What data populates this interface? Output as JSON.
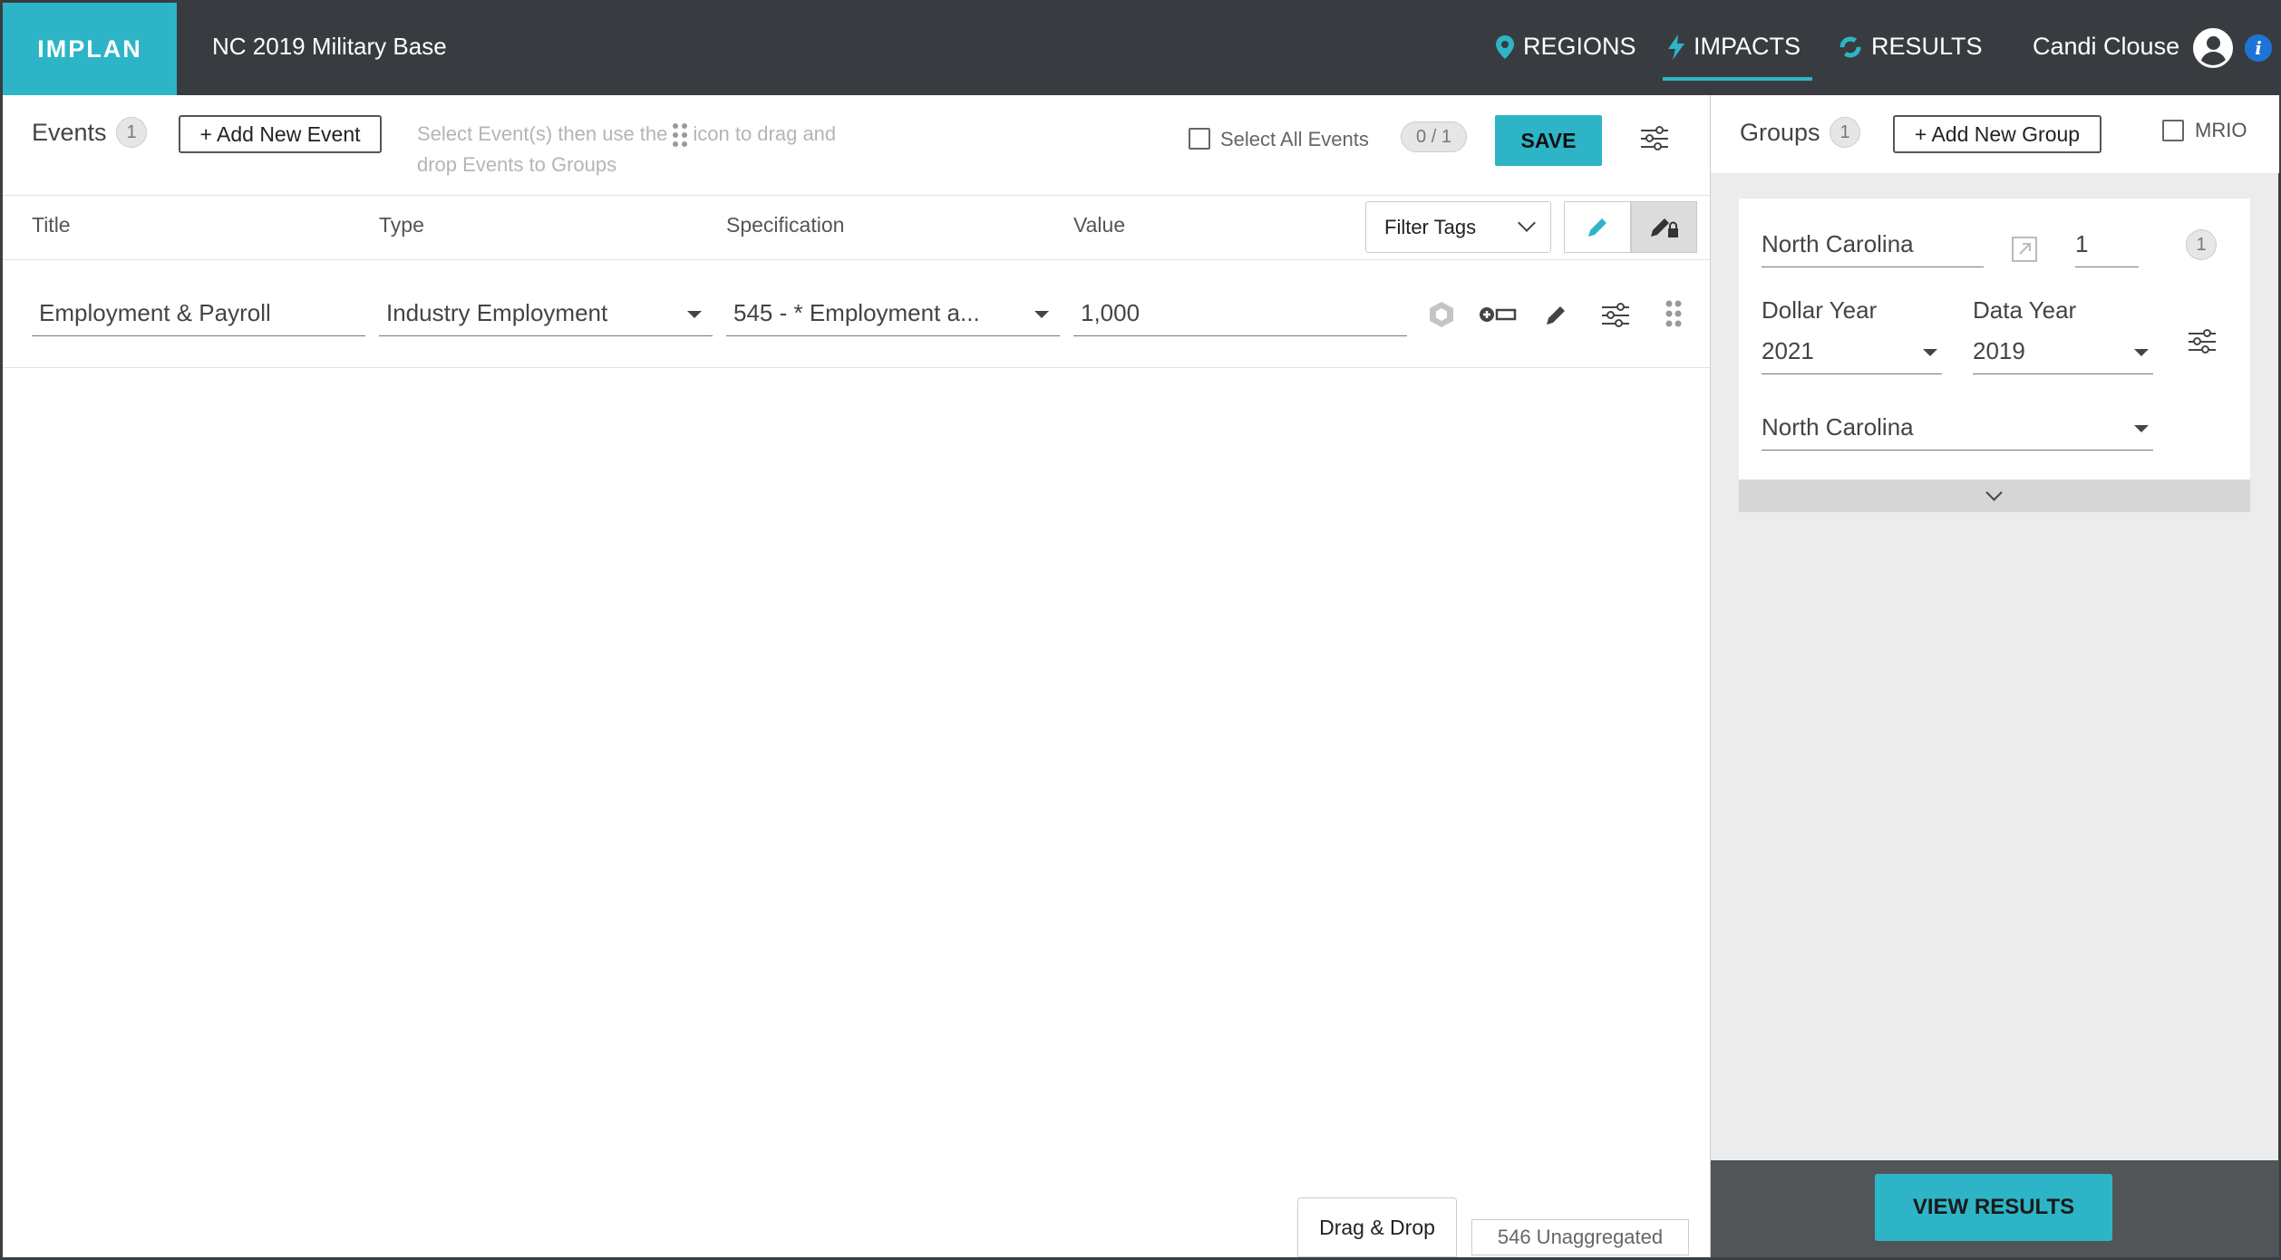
{
  "app": {
    "logo": "IMPLAN",
    "project_title": "NC 2019 Military Base",
    "nav": {
      "regions": "REGIONS",
      "impacts": "IMPACTS",
      "results": "RESULTS"
    },
    "user_name": "Candi Clouse",
    "info_glyph": "i",
    "accent_color": "#2db5c7",
    "header_color": "#383c40"
  },
  "events": {
    "label": "Events",
    "count": "1",
    "add_button": "+ Add New Event",
    "hint_part1": "Select Event(s) then use the",
    "hint_part2": "icon to drag and drop Events to Groups",
    "select_all_label": "Select All Events",
    "selected_count": "0 / 1",
    "save_label": "SAVE",
    "columns": {
      "title": "Title",
      "type": "Type",
      "specification": "Specification",
      "value": "Value"
    },
    "filter_tags": "Filter Tags",
    "rows": [
      {
        "title": "Employment & Payroll",
        "type": "Industry Employment",
        "specification": "545 - * Employment a...",
        "value": "1,000"
      }
    ],
    "drag_drop_label": "Drag & Drop",
    "unaggregated_label": "546 Unaggregated"
  },
  "groups": {
    "label": "Groups",
    "count": "1",
    "add_button": "+ Add New Group",
    "mrio_label": "MRIO",
    "card": {
      "name": "North Carolina",
      "scaling": "1",
      "event_count": "1",
      "dollar_year_label": "Dollar Year",
      "dollar_year": "2021",
      "data_year_label": "Data Year",
      "data_year": "2019",
      "region": "North Carolina"
    },
    "view_results": "VIEW RESULTS"
  },
  "icons": {
    "regions": "map-pin-icon",
    "impacts": "lightning-icon",
    "results": "refresh-cycle-icon",
    "user": "user-avatar-icon",
    "info": "info-icon",
    "drag": "drag-handle-icon",
    "settings": "sliders-icon"
  }
}
